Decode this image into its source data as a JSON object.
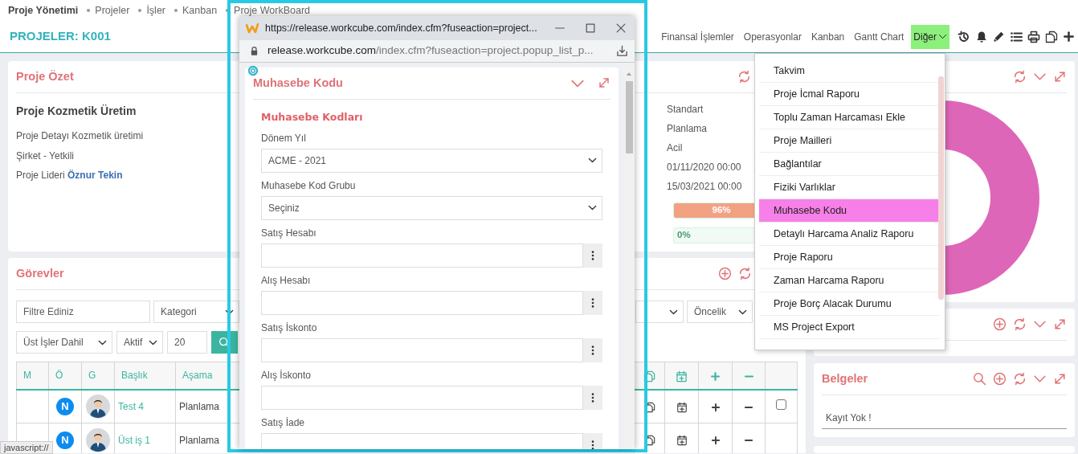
{
  "breadcrumb": {
    "title": "Proje Yönetimi",
    "links": [
      "Projeler",
      "İşler",
      "Kanban",
      "Proje WorkBoard"
    ]
  },
  "header": {
    "title": "PROJELER: K001",
    "tabs": [
      {
        "label": "Finansal İşlemler",
        "selected": false
      },
      {
        "label": "Operasyonlar",
        "selected": false
      },
      {
        "label": "Kanban",
        "selected": false
      },
      {
        "label": "Gantt Chart",
        "selected": false
      },
      {
        "label": "Diğer",
        "selected": true,
        "dropdown": true
      }
    ]
  },
  "project_summary": {
    "title": "Proje Özet",
    "name": "Proje Kozmetik Üretim",
    "details": [
      "Proje Detayı Kozmetik üretimi",
      "Şirket - Yetkili"
    ],
    "leader_label": "Proje Lideri",
    "leader_name": "Öznur Tekin",
    "values": [
      "Standart",
      "Planlama",
      "Acil",
      "01/11/2020 00:00",
      "15/03/2021 00:00"
    ],
    "progress": [
      {
        "label": "96%",
        "level": 0.96
      },
      {
        "label": "0%",
        "level": 0
      }
    ]
  },
  "tasks": {
    "title": "Görevler",
    "filter_placeholder": "Filtre Ediniz",
    "category": "Kategori",
    "priority": "Öncelik",
    "scope": "Üst İşler Dahil",
    "status": "Aktif",
    "page_size": "20",
    "columns": [
      "M",
      "Ö",
      "G",
      "Başlık",
      "Aşama"
    ],
    "rows": [
      {
        "initial": "N",
        "title": "Test 4",
        "stage": "Planlama",
        "checked": false
      },
      {
        "initial": "N",
        "title": "Üst iş 1",
        "stage": "Planlama"
      }
    ]
  },
  "documents": {
    "title": "Belgeler",
    "empty_text": "Kayıt Yok !"
  },
  "more_menu": {
    "items": [
      {
        "label": "Takvim",
        "selected": false
      },
      {
        "label": "Proje İcmal Raporu",
        "selected": false
      },
      {
        "label": "Toplu Zaman Harcaması Ekle",
        "selected": false
      },
      {
        "label": "Proje Mailleri",
        "selected": false
      },
      {
        "label": "Bağlantılar",
        "selected": false
      },
      {
        "label": "Fiziki Varlıklar",
        "selected": false
      },
      {
        "label": "Muhasebe Kodu",
        "selected": true
      },
      {
        "label": "Detaylı Harcama Analiz Raporu",
        "selected": false
      },
      {
        "label": "Proje Raporu",
        "selected": false
      },
      {
        "label": "Zaman Harcama Raporu",
        "selected": false
      },
      {
        "label": "Proje Borç Alacak Durumu",
        "selected": false
      },
      {
        "label": "MS Project Export",
        "selected": false
      }
    ]
  },
  "popup": {
    "window_title": "https://release.workcube.com/index.cfm?fuseaction=project...",
    "address_host": "release.workcube.com",
    "address_path": "/index.cfm?fuseaction=project.popup_list_p...",
    "title": "Muhasebe Kodu",
    "section_title": "Muhasebe Kodları",
    "fields": [
      {
        "label": "Dönem Yıl",
        "kind": "select",
        "value": "ACME - 2021"
      },
      {
        "label": "Muhasebe Kod Grubu",
        "kind": "select",
        "value": "Seçiniz"
      },
      {
        "label": "Satış Hesabı",
        "kind": "lookup"
      },
      {
        "label": "Alış Hesabı",
        "kind": "lookup"
      },
      {
        "label": "Satış İskonto",
        "kind": "lookup"
      },
      {
        "label": "Alış İskonto",
        "kind": "lookup"
      },
      {
        "label": "Satış İade",
        "kind": "lookup"
      }
    ]
  },
  "status_tooltip": "javascript://"
}
